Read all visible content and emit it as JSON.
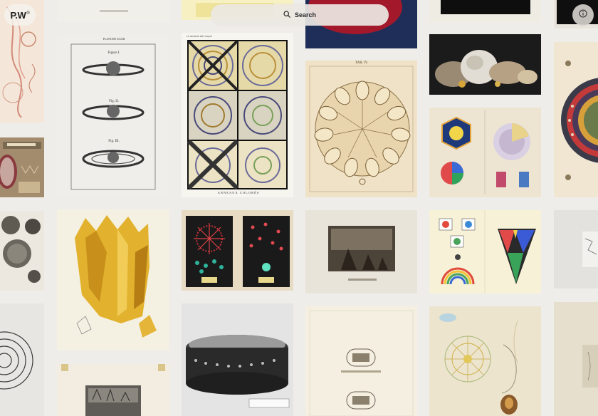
{
  "brand": {
    "logo_text": "P.W",
    "logo_mark": "®"
  },
  "search": {
    "label": "Search",
    "icon": "search-icon"
  },
  "info": {
    "icon": "info-icon"
  },
  "plates": {
    "saturn": {
      "caption_top": "PLANCHE XXXII",
      "fig1": "Figure I.",
      "fig2": "Fig. II.",
      "fig3": "Fig. III."
    },
    "anneaux": {
      "header": "LE MONDE PHYSIQUE",
      "caption": "ANNEAUX COLORÉS"
    },
    "tab": {
      "header": "TAB. IV."
    }
  },
  "colors": {
    "background": "#efedea",
    "accent_dark": "#1c1c1c"
  }
}
